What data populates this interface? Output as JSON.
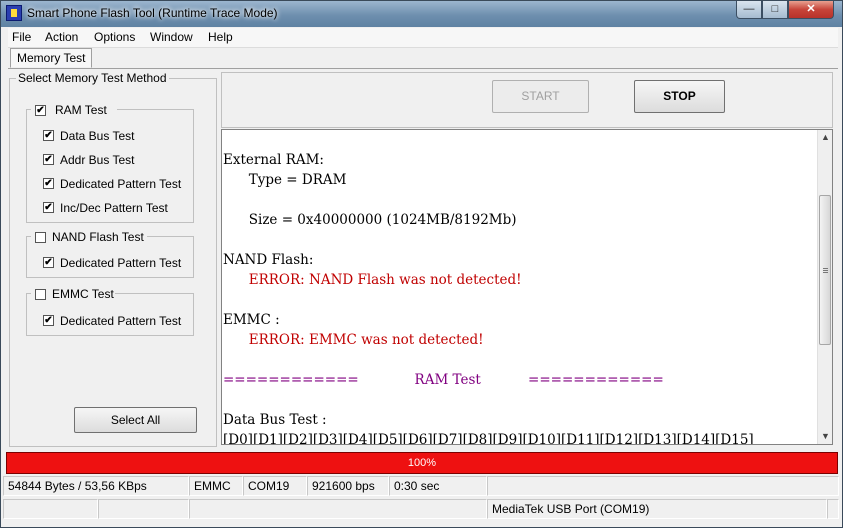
{
  "window": {
    "title": "Smart Phone Flash Tool (Runtime Trace Mode)"
  },
  "menu": [
    "File",
    "Action",
    "Options",
    "Window",
    "Help"
  ],
  "tabs": [
    {
      "label": "Memory Test",
      "active": true
    }
  ],
  "method_group": {
    "title": "Select Memory Test Method",
    "ram": {
      "label": "RAM Test",
      "checked": true,
      "items": [
        {
          "label": "Data Bus Test",
          "checked": true
        },
        {
          "label": "Addr Bus Test",
          "checked": true
        },
        {
          "label": "Dedicated Pattern Test",
          "checked": true
        },
        {
          "label": "Inc/Dec Pattern Test",
          "checked": true
        }
      ]
    },
    "nand": {
      "label": "NAND Flash Test",
      "checked": false,
      "items": [
        {
          "label": "Dedicated Pattern Test",
          "checked": true
        }
      ]
    },
    "emmc": {
      "label": "EMMC Test",
      "checked": false,
      "items": [
        {
          "label": "Dedicated Pattern Test",
          "checked": true
        }
      ]
    },
    "select_all": "Select All"
  },
  "controls": {
    "start": "START",
    "stop": "STOP",
    "start_enabled": false
  },
  "log": {
    "lines": [
      {
        "text": "",
        "color": "#000000"
      },
      {
        "text": "External RAM:",
        "color": "#000000"
      },
      {
        "text": "      Type = DRAM",
        "color": "#000000"
      },
      {
        "text": "",
        "color": "#000000"
      },
      {
        "text": "      Size = 0x40000000 (1024MB/8192Mb)",
        "color": "#000000"
      },
      {
        "text": "",
        "color": "#000000"
      },
      {
        "text": "NAND Flash:",
        "color": "#000000"
      },
      {
        "text": "      ERROR: NAND Flash was not detected!",
        "color": "#c00000"
      },
      {
        "text": "",
        "color": "#000000"
      },
      {
        "text": "EMMC :",
        "color": "#000000"
      },
      {
        "text": "      ERROR: EMMC was not detected!",
        "color": "#c00000"
      },
      {
        "text": "",
        "color": "#000000"
      },
      {
        "text": "============             RAM Test           ============",
        "color": "#800080"
      },
      {
        "text": "",
        "color": "#000000"
      },
      {
        "text": "Data Bus Test :",
        "color": "#000000"
      },
      {
        "text": "[D0][D1][D2][D3][D4][D5][D6][D7][D8][D9][D10][D11][D12][D13][D14][D15]",
        "color": "#000000"
      }
    ]
  },
  "progress": {
    "value": 1.0,
    "label": "100%",
    "color": "#ee1111"
  },
  "status": {
    "transfer": "54844 Bytes / 53,56 KBps",
    "storage": "EMMC",
    "port": "COM19",
    "baud": "921600 bps",
    "elapsed": "0:30 sec",
    "device": "MediaTek USB Port (COM19)"
  }
}
